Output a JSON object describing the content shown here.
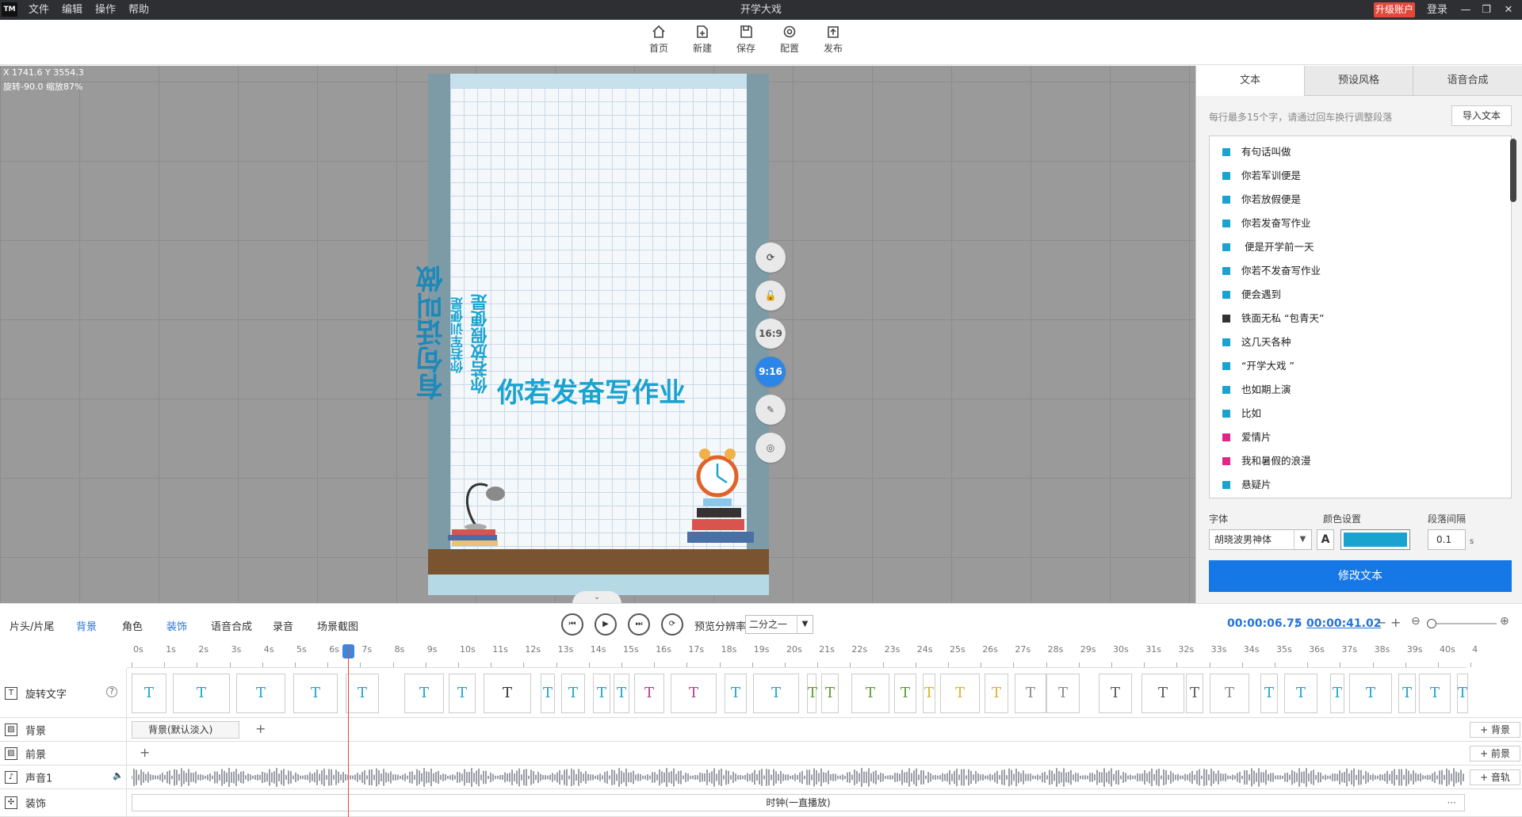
{
  "app": {
    "logo": "TM",
    "title": "开学大戏",
    "menus": [
      "文件",
      "编辑",
      "操作",
      "帮助"
    ],
    "upgrade": "升级账户",
    "login": "登录"
  },
  "toolbar": {
    "home": "首页",
    "new": "新建",
    "save": "保存",
    "config": "配置",
    "publish": "发布"
  },
  "canvas": {
    "coords": "X 1741.6 Y 3554.3",
    "transform": "旋转-90.0 缩放87%",
    "vtext_big": "有句话叫做",
    "vtext_mid1": "你若军训便是",
    "vtext_mid2": "你若放假便是",
    "main_text": "你若发奋写作业",
    "ratio_169": "16:9",
    "ratio_916": "9:16"
  },
  "panel": {
    "tabs": [
      "文本",
      "预设风格",
      "语音合成"
    ],
    "hint": "每行最多15个字，请通过回车换行调整段落",
    "import": "导入文本",
    "items": [
      {
        "text": "有句话叫做",
        "color": "#1ba3d0"
      },
      {
        "text": "你若军训便是",
        "color": "#1ba3d0"
      },
      {
        "text": "你若放假便是",
        "color": "#1ba3d0"
      },
      {
        "text": "你若发奋写作业",
        "color": "#1ba3d0"
      },
      {
        "text": "  便是开学前一天",
        "color": "#1ba3d0"
      },
      {
        "text": "你若不发奋写作业",
        "color": "#1ba3d0"
      },
      {
        "text": "便会遇到",
        "color": "#1ba3d0"
      },
      {
        "text": "铁面无私 “包青天”",
        "color": "#333333"
      },
      {
        "text": "这几天各种",
        "color": "#1ba3d0"
      },
      {
        "text": "“开学大戏 ”",
        "color": "#1ba3d0"
      },
      {
        "text": "也如期上演",
        "color": "#1ba3d0"
      },
      {
        "text": "比如",
        "color": "#1ba3d0"
      },
      {
        "text": "爱情片",
        "color": "#e0258a"
      },
      {
        "text": "我和暑假的浪漫",
        "color": "#e0258a"
      },
      {
        "text": "悬疑片",
        "color": "#1ba3d0"
      }
    ],
    "font_label": "字体",
    "color_label": "颜色设置",
    "spacing_label": "段落间隔",
    "font": "胡晓波男神体",
    "color": "#1ba3d0",
    "spacing": "0.1",
    "spacing_unit": "s",
    "modify": "修改文本"
  },
  "timeline": {
    "tabs": [
      "片头/片尾",
      "背景",
      "角色",
      "装饰",
      "语音合成",
      "录音",
      "场景截图"
    ],
    "res_label": "预览分辨率",
    "res_value": "二分之一",
    "current": "00:00:06.75",
    "sep": "/",
    "total": "00:00:41.02",
    "ticks": [
      "0s",
      "1s",
      "2s",
      "3s",
      "4s",
      "5s",
      "6s",
      "7s",
      "8s",
      "9s",
      "10s",
      "11s",
      "12s",
      "13s",
      "14s",
      "15s",
      "16s",
      "17s",
      "18s",
      "19s",
      "20s",
      "21s",
      "22s",
      "23s",
      "24s",
      "25s",
      "26s",
      "27s",
      "28s",
      "29s",
      "30s",
      "31s",
      "32s",
      "33s",
      "34s",
      "35s",
      "36s",
      "37s",
      "38s",
      "39s",
      "40s",
      "4"
    ],
    "tracks": {
      "text": "旋转文字",
      "bg": "背景",
      "fg": "前景",
      "audio": "声音1",
      "deco": "装饰"
    },
    "bg_clip": "背景(默认淡入)",
    "add_bg": "+ 背景",
    "add_fg": "+ 前景",
    "add_audio": "+ 音轨",
    "deco_clip": "时钟(一直播放)",
    "help": "?",
    "plus": "+",
    "more": "···"
  }
}
